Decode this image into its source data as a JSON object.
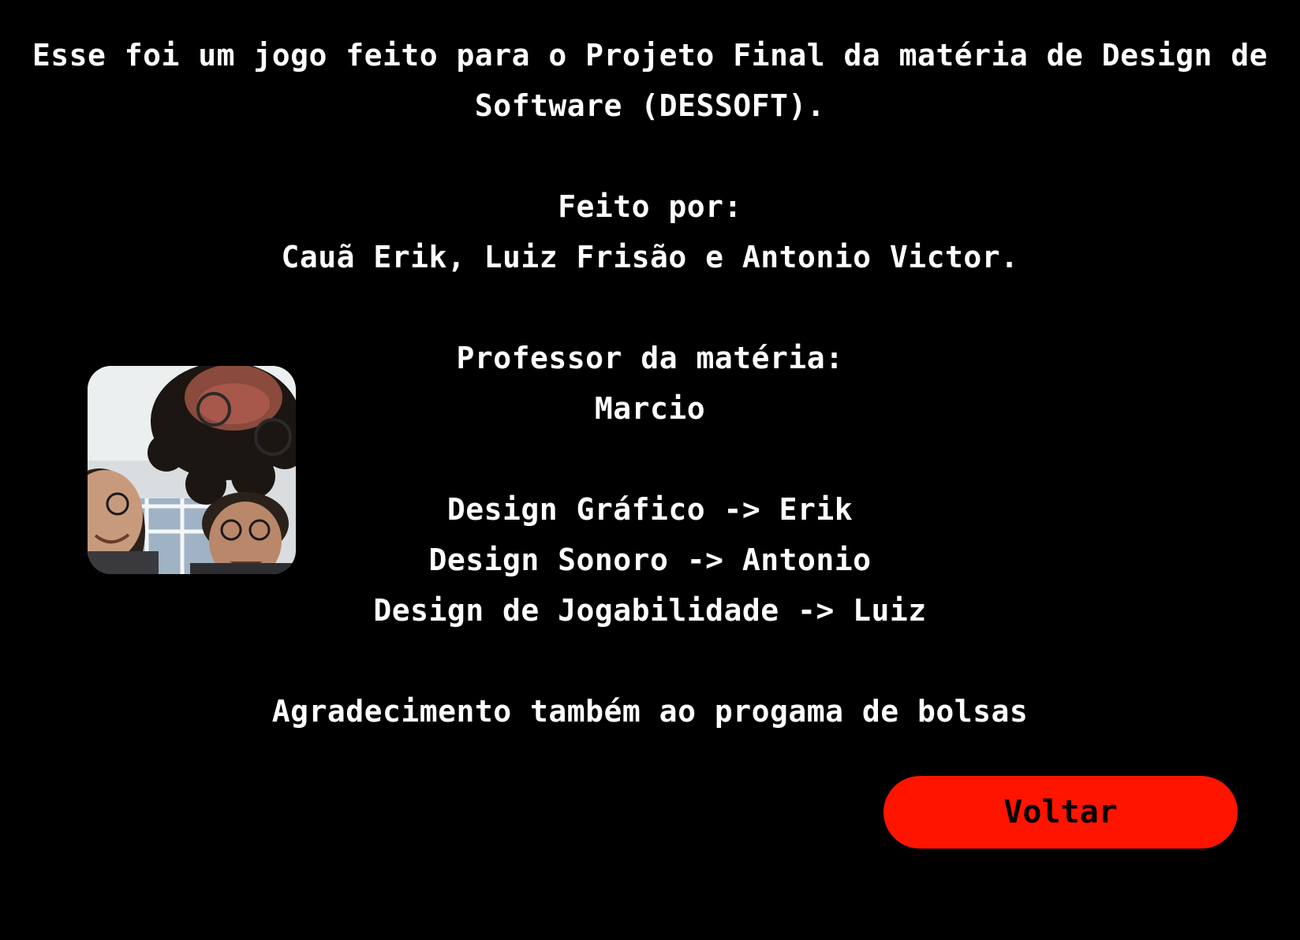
{
  "credits": {
    "intro_line1": "Esse foi um jogo feito para o Projeto Final da matéria de Design de",
    "intro_line2": "Software (DESSOFT).",
    "made_by_label": "Feito por:",
    "made_by_names": "Cauã Erik, Luiz Frisão e Antonio Victor.",
    "professor_label": "Professor da matéria:",
    "professor_name": "Marcio",
    "role_graphic": "Design Gráfico -> Erik",
    "role_sound": "Design Sonoro -> Antonio",
    "role_gameplay": "Design de Jogabilidade -> Luiz",
    "thanks": "Agradecimento também ao progama de bolsas"
  },
  "photo": {
    "subject": "team-selfie"
  },
  "back_button": {
    "label": "Voltar",
    "color": "#ff1400"
  },
  "colors": {
    "background": "#000000",
    "text": "#ffffff"
  }
}
